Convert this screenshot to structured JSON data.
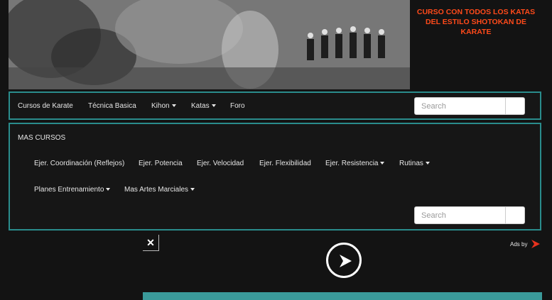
{
  "promo": {
    "text": "CURSO CON TODOS LOS KATAS DEL ESTILO SHOTOKAN DE KARATE"
  },
  "navbar": {
    "items": [
      {
        "label": "Cursos de Karate",
        "dropdown": false
      },
      {
        "label": "Técnica Basica",
        "dropdown": false
      },
      {
        "label": "Kihon",
        "dropdown": true
      },
      {
        "label": "Katas",
        "dropdown": true
      },
      {
        "label": "Foro",
        "dropdown": false
      }
    ],
    "search_placeholder": "Search"
  },
  "panel": {
    "title": "MAS CURSOS",
    "items": [
      {
        "label": "Ejer. Coordinación (Reflejos)",
        "dropdown": false
      },
      {
        "label": "Ejer. Potencia",
        "dropdown": false
      },
      {
        "label": "Ejer. Velocidad",
        "dropdown": false
      },
      {
        "label": "Ejer. Flexibilidad",
        "dropdown": false
      },
      {
        "label": "Ejer. Resistencia",
        "dropdown": true
      },
      {
        "label": "Rutinas",
        "dropdown": true
      },
      {
        "label": "Planes Entrenamiento",
        "dropdown": true
      },
      {
        "label": "Mas Artes Marciales",
        "dropdown": true
      }
    ],
    "search_placeholder": "Search"
  },
  "ad": {
    "close_symbol": "✕",
    "ads_by_label": "Ads by"
  },
  "colors": {
    "accent_border": "#2a8c8c",
    "promo_text": "#ff4a1a",
    "background": "#131313"
  },
  "icons": [
    "close-icon",
    "play-icon",
    "ads-logo-icon",
    "search-icon"
  ]
}
